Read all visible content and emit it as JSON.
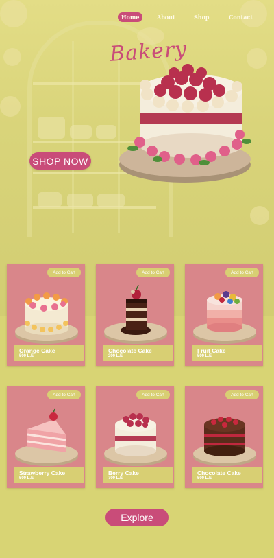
{
  "nav": {
    "home": "Home",
    "about": "About",
    "shop": "Shop",
    "contact": "Contact"
  },
  "hero": {
    "brand": "Bakery",
    "cta": "SHOP NOW"
  },
  "products": [
    {
      "name": "Orange Cake",
      "price": "500 L.E",
      "cart": "Add to Cart"
    },
    {
      "name": "Chocolate  Cake",
      "price": "200 L.E",
      "cart": "Add to Cart"
    },
    {
      "name": "Fruit Cake",
      "price": "500 L.E",
      "cart": "Add to Cart"
    },
    {
      "name": "Strawberry  Cake",
      "price": "500 L.E",
      "cart": "Add to Cart"
    },
    {
      "name": "Berry  Cake",
      "price": "700 L.E",
      "cart": "Add to Cart"
    },
    {
      "name": "Chocolate  Cake",
      "price": "500 L.E",
      "cart": "Add to Cart"
    }
  ],
  "explore": "Explore",
  "colors": {
    "background": "#d8d474",
    "accent": "#c94c79",
    "card": "#d9868a",
    "label": "#d8cf73"
  }
}
